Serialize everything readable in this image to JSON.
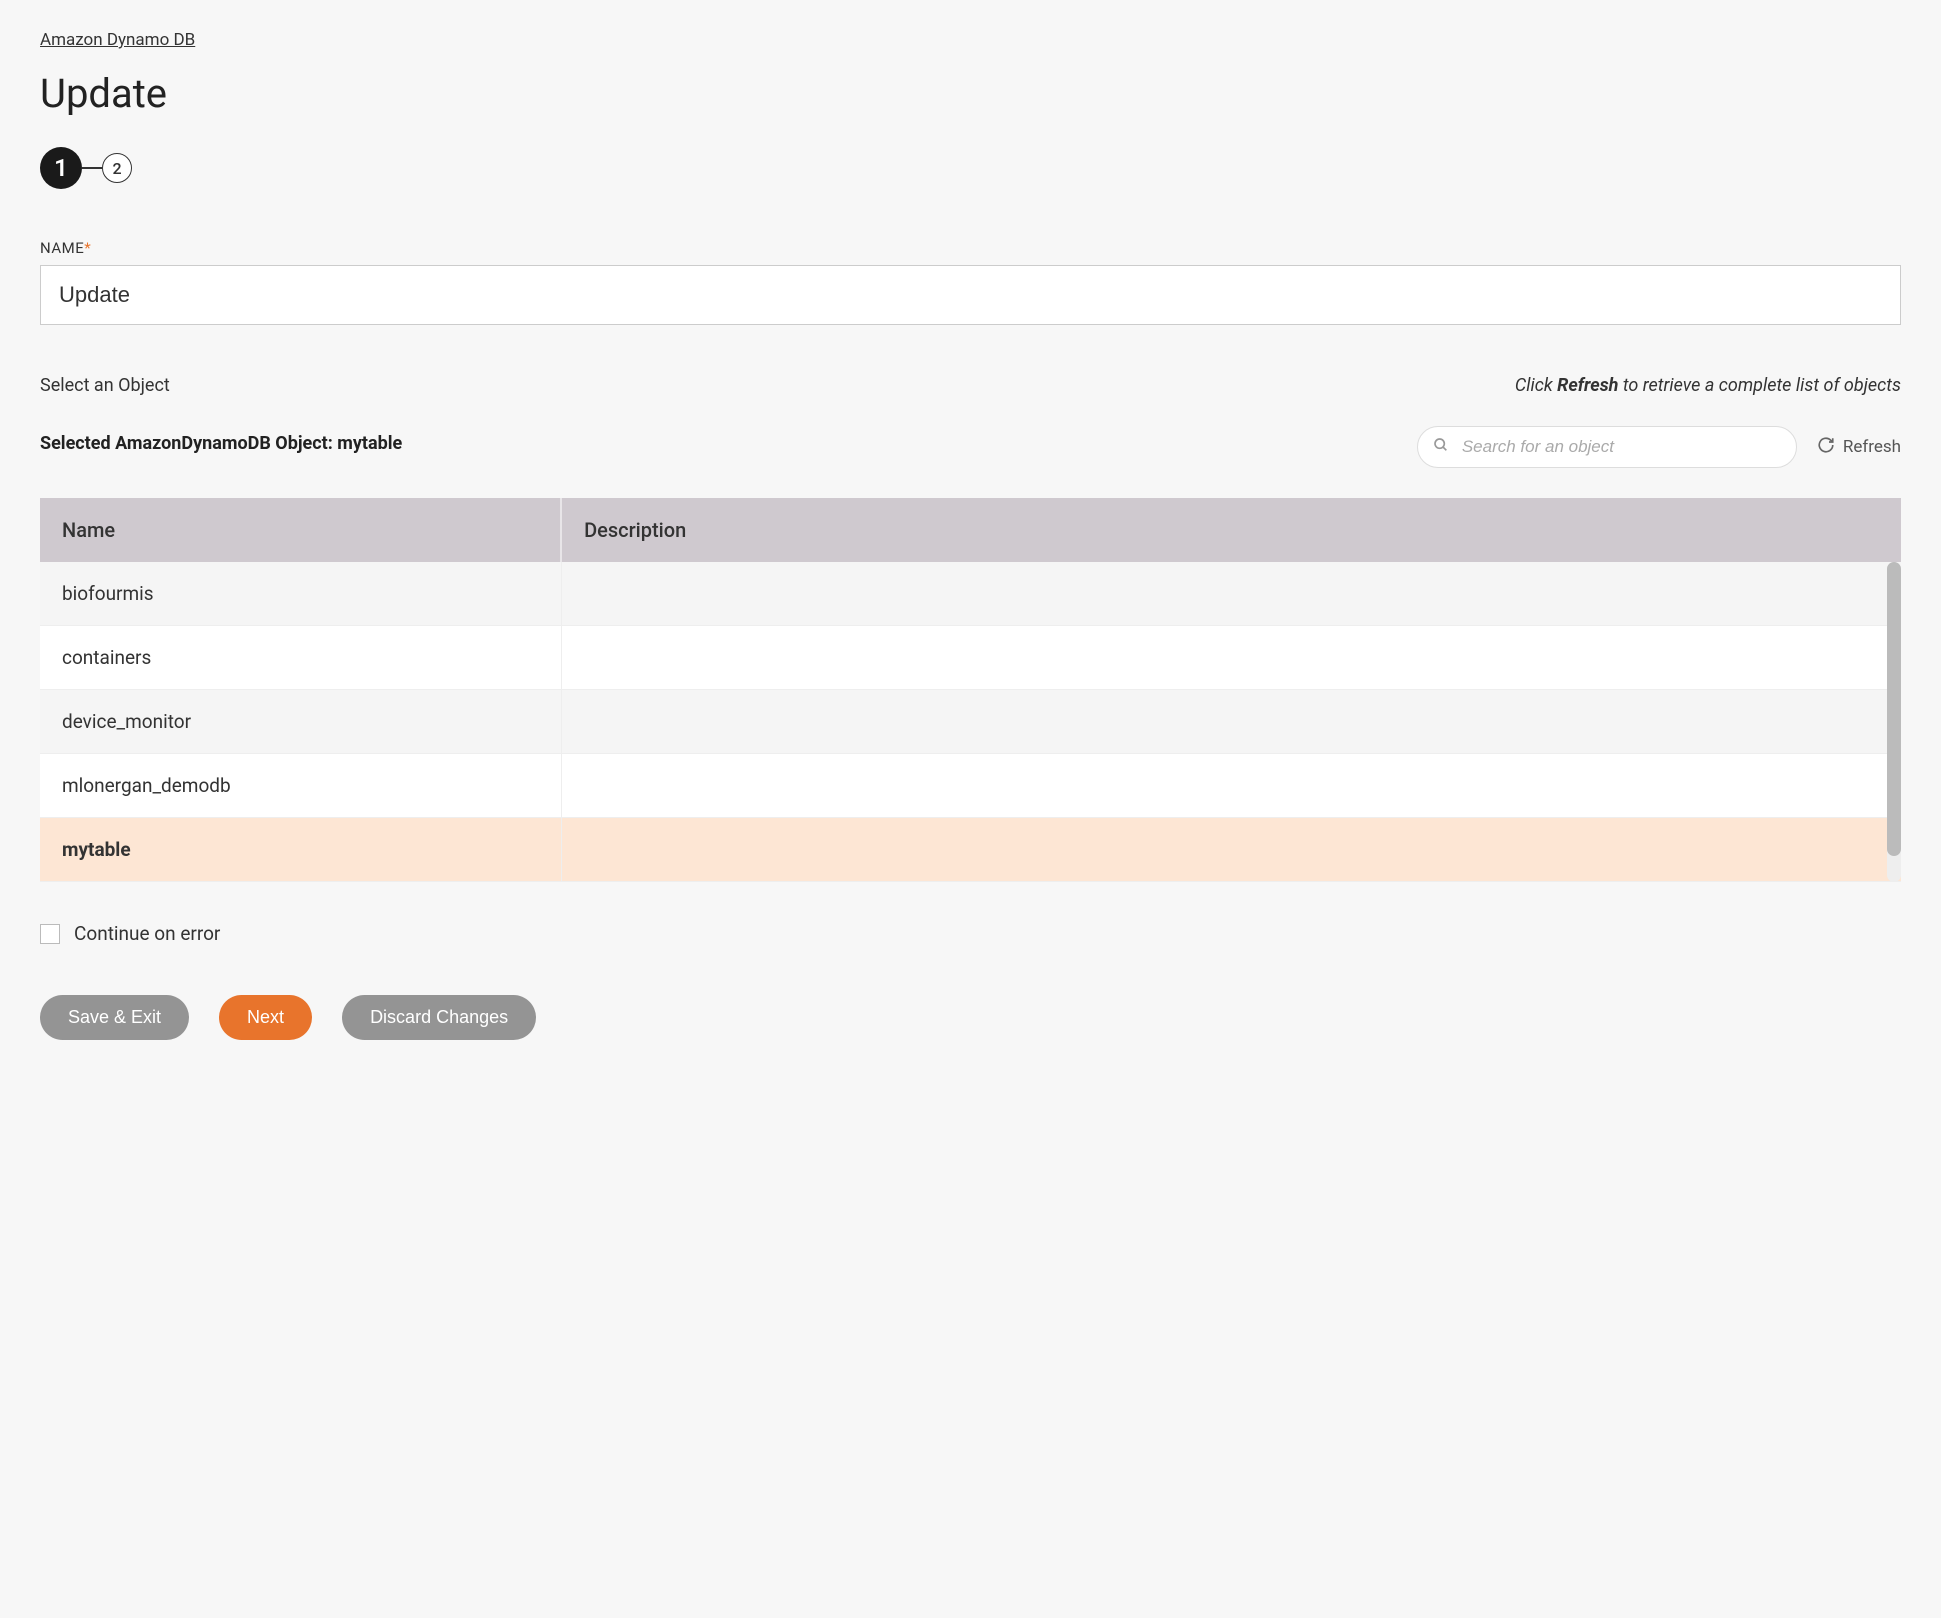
{
  "breadcrumb": "Amazon Dynamo DB",
  "page_title": "Update",
  "stepper": {
    "step1": "1",
    "step2": "2"
  },
  "name_field": {
    "label": "NAME",
    "value": "Update"
  },
  "object_section": {
    "select_label": "Select an Object",
    "selected_prefix": "Selected AmazonDynamoDB Object: ",
    "selected_value": "mytable",
    "hint_prefix": "Click ",
    "hint_bold": "Refresh",
    "hint_suffix": " to retrieve a complete list of objects",
    "search_placeholder": "Search for an object",
    "refresh_label": "Refresh"
  },
  "table": {
    "headers": {
      "name": "Name",
      "description": "Description"
    },
    "rows": [
      {
        "name": "biofourmis",
        "description": "",
        "selected": false
      },
      {
        "name": "containers",
        "description": "",
        "selected": false
      },
      {
        "name": "device_monitor",
        "description": "",
        "selected": false
      },
      {
        "name": "mlonergan_demodb",
        "description": "",
        "selected": false
      },
      {
        "name": "mytable",
        "description": "",
        "selected": true
      }
    ]
  },
  "continue_on_error_label": "Continue on error",
  "buttons": {
    "save_exit": "Save & Exit",
    "next": "Next",
    "discard": "Discard Changes"
  }
}
